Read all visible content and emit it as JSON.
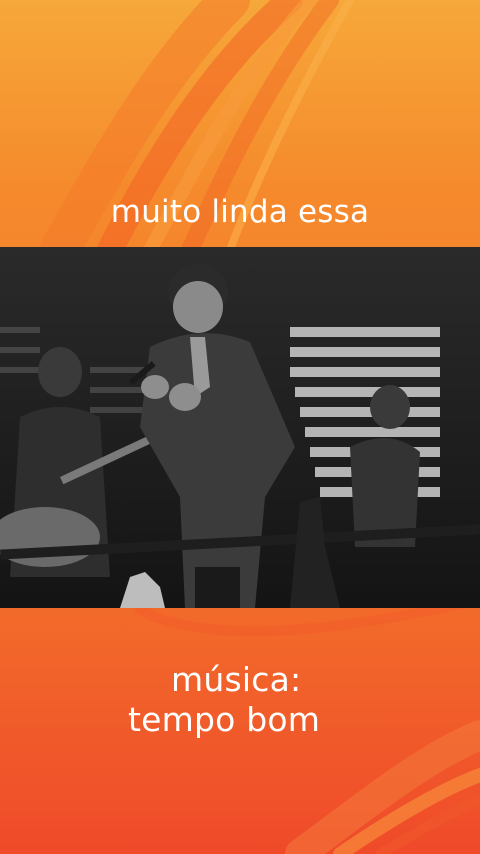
{
  "overlay": {
    "top_caption": "muito linda essa",
    "bottom_caption_line1": "música:",
    "bottom_caption_line2": "tempo bom"
  },
  "colors": {
    "gradient_top": "#f6a83a",
    "gradient_bottom": "#ef4a2a",
    "caption_text": "#ffffff"
  }
}
